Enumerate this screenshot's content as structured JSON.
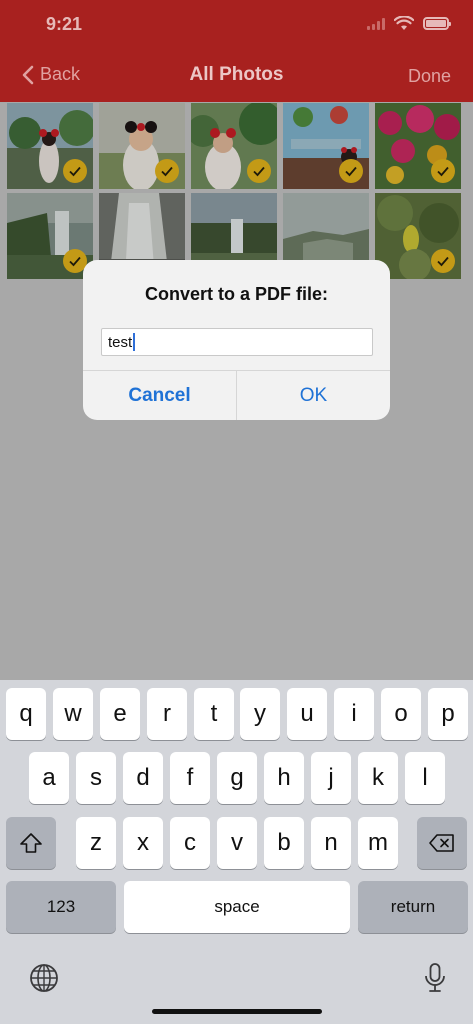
{
  "status_bar": {
    "time": "9:21"
  },
  "nav": {
    "back_label": "Back",
    "title": "All Photos",
    "done_label": "Done"
  },
  "photos": {
    "count": 10,
    "selected": [
      true,
      true,
      true,
      true,
      true,
      true,
      false,
      false,
      false,
      true
    ]
  },
  "dialog": {
    "title": "Convert to a PDF file:",
    "input_value": "test",
    "cancel_label": "Cancel",
    "ok_label": "OK"
  },
  "keyboard": {
    "row1": [
      "q",
      "w",
      "e",
      "r",
      "t",
      "y",
      "u",
      "i",
      "o",
      "p"
    ],
    "row2": [
      "a",
      "s",
      "d",
      "f",
      "g",
      "h",
      "j",
      "k",
      "l"
    ],
    "row3": [
      "z",
      "x",
      "c",
      "v",
      "b",
      "n",
      "m"
    ],
    "numbers_label": "123",
    "space_label": "space",
    "return_label": "return"
  },
  "colors": {
    "header": "#a8211f",
    "accent_blue": "#1f72d6",
    "check_badge": "#c39a16"
  }
}
